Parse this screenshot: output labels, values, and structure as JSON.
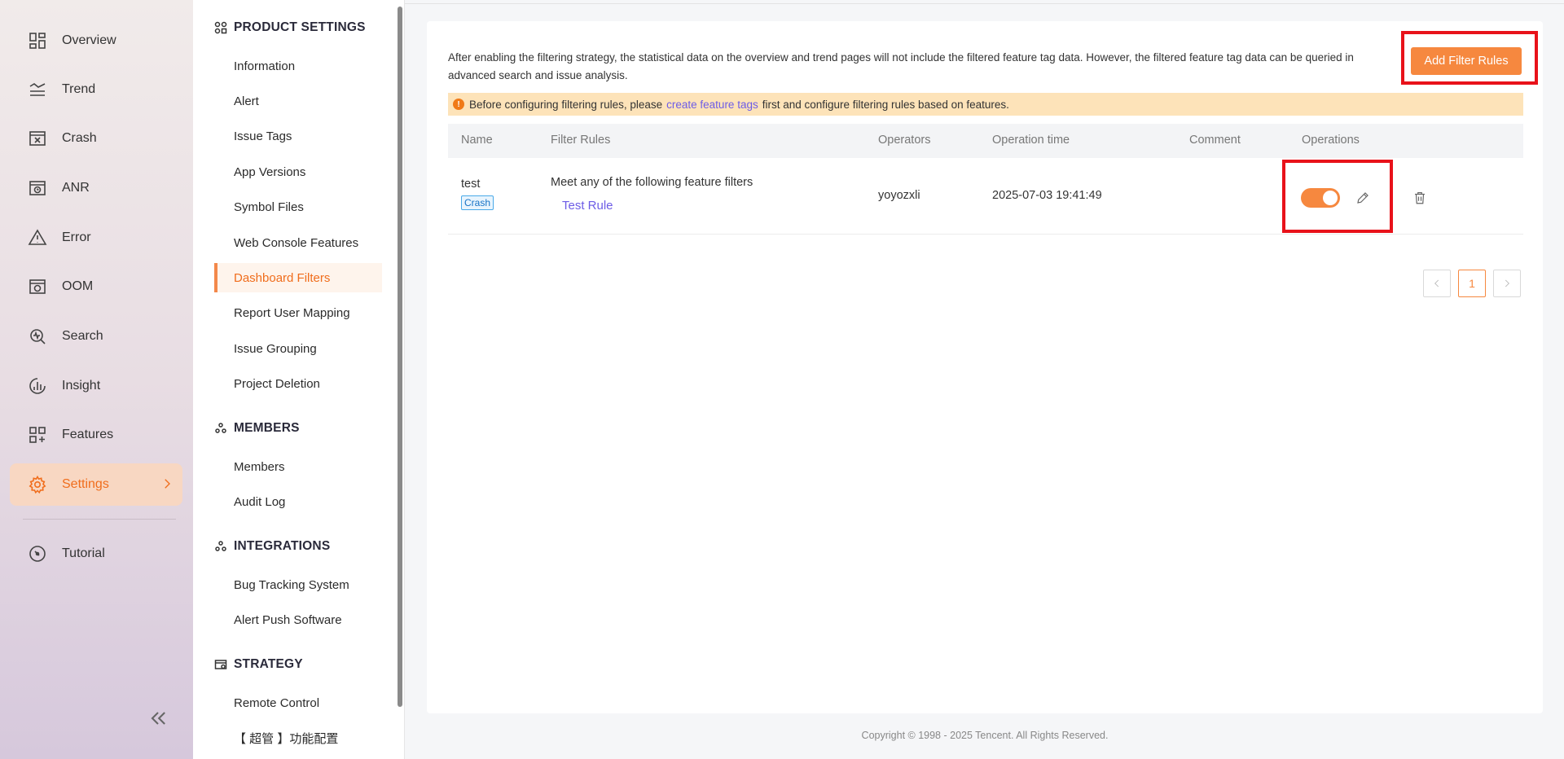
{
  "nav": {
    "items": [
      {
        "label": "Overview",
        "icon": "overview-icon"
      },
      {
        "label": "Trend",
        "icon": "trend-icon"
      },
      {
        "label": "Crash",
        "icon": "crash-icon"
      },
      {
        "label": "ANR",
        "icon": "anr-icon"
      },
      {
        "label": "Error",
        "icon": "error-icon"
      },
      {
        "label": "OOM",
        "icon": "oom-icon"
      },
      {
        "label": "Search",
        "icon": "search-icon"
      },
      {
        "label": "Insight",
        "icon": "insight-icon"
      },
      {
        "label": "Features",
        "icon": "features-icon"
      },
      {
        "label": "Settings",
        "icon": "gear-icon",
        "active": true
      },
      {
        "label": "Tutorial",
        "icon": "tutorial-icon"
      }
    ]
  },
  "menu": {
    "product_settings": {
      "title": "PRODUCT SETTINGS",
      "items": [
        "Information",
        "Alert",
        "Issue Tags",
        "App Versions",
        "Symbol Files",
        "Web Console Features",
        "Dashboard Filters",
        "Report User Mapping",
        "Issue Grouping",
        "Project Deletion"
      ]
    },
    "members": {
      "title": "MEMBERS",
      "items": [
        "Members",
        "Audit Log"
      ]
    },
    "integrations": {
      "title": "INTEGRATIONS",
      "items": [
        "Bug Tracking System",
        "Alert Push Software"
      ]
    },
    "strategy": {
      "title": "STRATEGY",
      "items": [
        "Remote Control",
        "【 超管 】功能配置"
      ]
    },
    "active_item": "Dashboard Filters"
  },
  "main": {
    "description": "After enabling the filtering strategy, the statistical data on the overview and trend pages will not include the filtered feature tag data. However, the filtered feature tag data can be queried in advanced search and issue analysis.",
    "add_button": "Add Filter Rules",
    "notice": {
      "before": "Before configuring filtering rules, please",
      "link": "create feature tags",
      "after": "first and configure filtering rules based on features."
    },
    "table": {
      "headers": [
        "Name",
        "Filter Rules",
        "Operators",
        "Operation time",
        "Comment",
        "Operations"
      ],
      "rows": [
        {
          "name": "test",
          "tag": "Crash",
          "filter_title": "Meet any of the following feature filters",
          "filter_link": "Test Rule",
          "operator": "yoyozxli",
          "time": "2025-07-03 19:41:49",
          "comment": "",
          "enabled": true
        }
      ]
    },
    "pagination": {
      "current": "1"
    }
  },
  "colors": {
    "accent": "#f6883f",
    "highlight": "#e8121a",
    "link": "#6d5ce6"
  },
  "footer": {
    "copyright": "Copyright © 1998 - 2025 Tencent. All Rights Reserved."
  }
}
